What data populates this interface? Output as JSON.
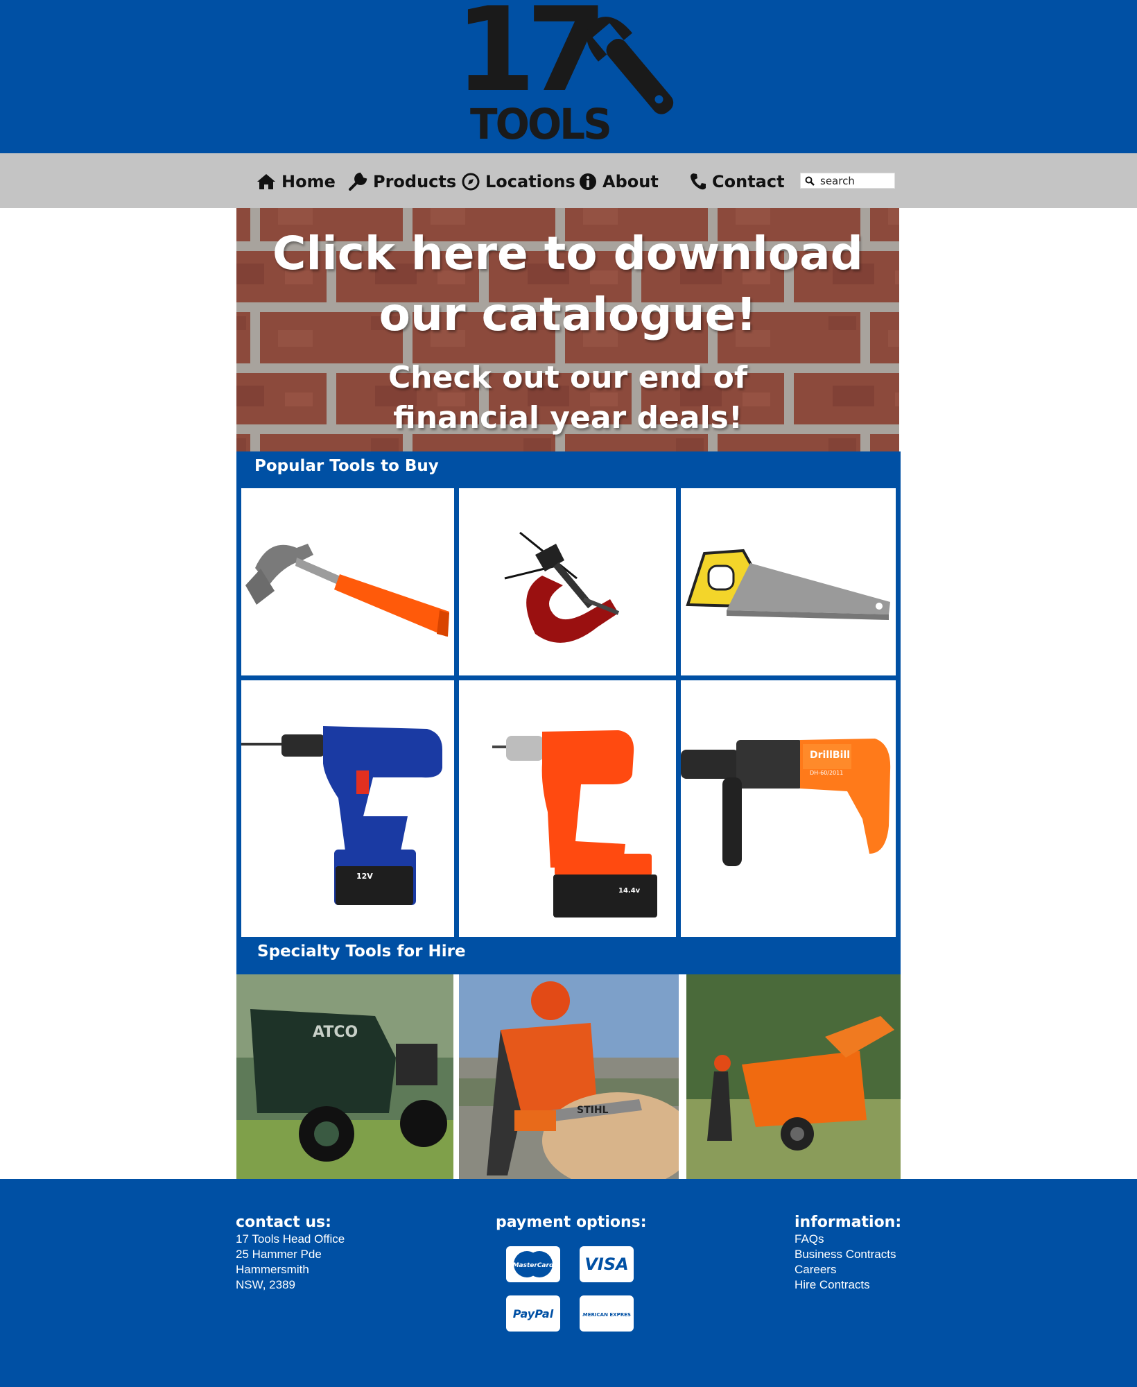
{
  "header": {
    "logo_number": "17",
    "logo_word": "TOOLS",
    "logo_icon": "wrench-icon",
    "background_color": "#0050a4"
  },
  "nav": {
    "items": [
      {
        "label": "Home",
        "icon": "home-icon"
      },
      {
        "label": "Products",
        "icon": "wrench-icon"
      },
      {
        "label": "Locations",
        "icon": "compass-icon"
      },
      {
        "label": "About",
        "icon": "info-icon"
      },
      {
        "label": "Contact",
        "icon": "phone-icon"
      }
    ],
    "search_placeholder": "search",
    "background_color": "#c4c4c4"
  },
  "banner": {
    "title_line1": "Click here to download",
    "title_line2": "our catalogue!",
    "subtitle_line1": "Check out our end of",
    "subtitle_line2": "financial year deals!"
  },
  "popular": {
    "title": "Popular Tools to Buy",
    "items": [
      {
        "icon": "claw-hammer-icon"
      },
      {
        "icon": "g-clamp-icon"
      },
      {
        "icon": "hand-saw-icon"
      },
      {
        "icon": "blue-cordless-drill-icon",
        "badge": "12V"
      },
      {
        "icon": "orange-cordless-drill-icon",
        "badge": "14.4v"
      },
      {
        "icon": "rotary-hammer-drill-icon",
        "brand": "DrillBill",
        "model": "DH-60/2011"
      }
    ]
  },
  "hire": {
    "title": "Specialty Tools for Hire",
    "items": [
      {
        "icon": "ride-on-mower-photo",
        "brand": "ATCO"
      },
      {
        "icon": "chainsaw-worker-photo",
        "brand": "STIHL"
      },
      {
        "icon": "wood-chipper-photo"
      }
    ]
  },
  "footer": {
    "contact": {
      "heading": "contact us:",
      "lines": [
        "17 Tools Head Office",
        "25 Hammer Pde",
        "Hammersmith",
        "NSW, 2389"
      ]
    },
    "payment": {
      "heading": "payment options:",
      "cards": [
        "MasterCard",
        "VISA",
        "PayPal",
        "AMERICAN EXPRESS"
      ]
    },
    "information": {
      "heading": "information:",
      "links": [
        "FAQs",
        "Business Contracts",
        "Careers",
        "Hire Contracts"
      ]
    }
  }
}
